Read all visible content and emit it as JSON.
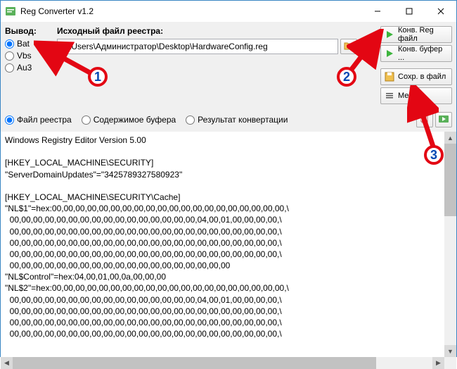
{
  "window": {
    "title": "Reg Converter v1.2"
  },
  "output": {
    "title": "Вывод:",
    "opts": [
      "Bat",
      "Vbs",
      "Au3"
    ],
    "selected": "Bat"
  },
  "source": {
    "title": "Исходный файл реестра:",
    "path": "C:\\Users\\Администратор\\Desktop\\HardwareConfig.reg"
  },
  "buttons": {
    "convReg": "Конв. Reg файл",
    "convBuf": "Конв. буфер ...",
    "saveFile": "Сохр. в файл",
    "menu": "Меню"
  },
  "row2": {
    "optFile": "Файл реестра",
    "optBuf": "Содержимое буфера",
    "optResult": "Результат конвертации"
  },
  "editorText": "Windows Registry Editor Version 5.00\n\n[HKEY_LOCAL_MACHINE\\SECURITY]\n\"ServerDomainUpdates\"=\"3425789327580923\"\n\n[HKEY_LOCAL_MACHINE\\SECURITY\\Cache]\n\"NL$1\"=hex:00,00,00,00,00,00,00,00,00,00,00,00,00,00,00,00,00,00,00,00,\\\n  00,00,00,00,00,00,00,00,00,00,00,00,00,00,00,00,04,00,01,00,00,00,00,\\\n  00,00,00,00,00,00,00,00,00,00,00,00,00,00,00,00,00,00,00,00,00,00,00,\\\n  00,00,00,00,00,00,00,00,00,00,00,00,00,00,00,00,00,00,00,00,00,00,00,\\\n  00,00,00,00,00,00,00,00,00,00,00,00,00,00,00,00,00,00,00,00,00,00,00,\\\n  00,00,00,00,00,00,00,00,00,00,00,00,00,00,00,00,00,00,00\n\"NL$Control\"=hex:04,00,01,00,0a,00,00,00\n\"NL$2\"=hex:00,00,00,00,00,00,00,00,00,00,00,00,00,00,00,00,00,00,00,00,\\\n  00,00,00,00,00,00,00,00,00,00,00,00,00,00,00,00,04,00,01,00,00,00,00,\\\n  00,00,00,00,00,00,00,00,00,00,00,00,00,00,00,00,00,00,00,00,00,00,00,\\\n  00,00,00,00,00,00,00,00,00,00,00,00,00,00,00,00,00,00,00,00,00,00,00,\\\n  00,00,00,00,00,00,00,00,00,00,00,00,00,00,00,00,00,00,00,00,00,00,00,\\",
  "annotations": {
    "n1": "1",
    "n2": "2",
    "n3": "3"
  }
}
